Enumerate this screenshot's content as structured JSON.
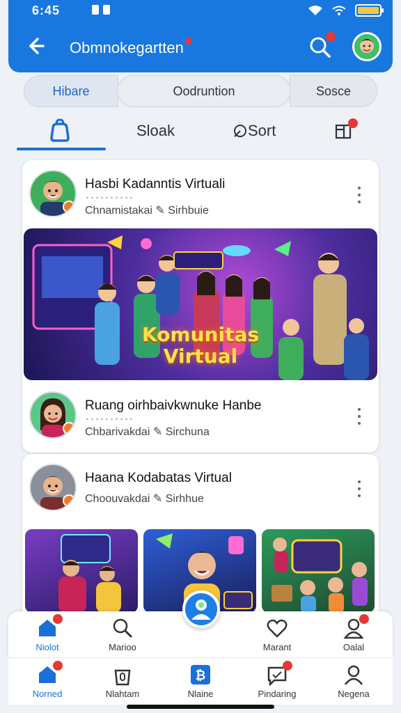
{
  "status_bar": {
    "time": "6:45"
  },
  "header": {
    "title": "Obmnokegartten"
  },
  "segments": [
    "Hibare",
    "Oodruntion",
    "Sosce"
  ],
  "tabs": [
    {
      "label": "",
      "icon": "home-bag-icon"
    },
    {
      "label": "Sloak"
    },
    {
      "label": "Sort",
      "icon": "sort-icon"
    },
    {
      "label": "",
      "icon": "bookmark-box-icon"
    }
  ],
  "posts": [
    {
      "name": "Hasbi Kadanntis Virtuali",
      "subtitle": "Chnamistakai",
      "meta": "Sirhbuie",
      "image_title_line1": "Komunitas",
      "image_title_line2": "Virtual"
    },
    {
      "name": "Ruang oirhbaivkwnuke Hanbe",
      "subtitle": "Chbarivakdai",
      "meta": "Sirchuna"
    },
    {
      "name": "Haana Kodabatas Virtual",
      "subtitle": "Choouvakdai",
      "meta": "Sirhhue"
    }
  ],
  "nav_row1": [
    {
      "label": "Niolot",
      "icon": "home-icon"
    },
    {
      "label": "Marioo",
      "icon": "search-icon"
    },
    {
      "label": "",
      "icon": "profile-fab-icon"
    },
    {
      "label": "Marant",
      "icon": "heart-icon"
    },
    {
      "label": "Oalal",
      "icon": "user-icon"
    }
  ],
  "nav_row2": [
    {
      "label": "Norned",
      "icon": "home-icon"
    },
    {
      "label": "Nlahtam",
      "icon": "bag-icon"
    },
    {
      "label": "Nlaine",
      "icon": "bitcoin-icon"
    },
    {
      "label": "Pindaring",
      "icon": "chat-icon"
    },
    {
      "label": "Negena",
      "icon": "person-icon"
    }
  ],
  "colors": {
    "primary": "#1878e0",
    "badge": "#e53935",
    "accent": "#1a6fd8"
  }
}
